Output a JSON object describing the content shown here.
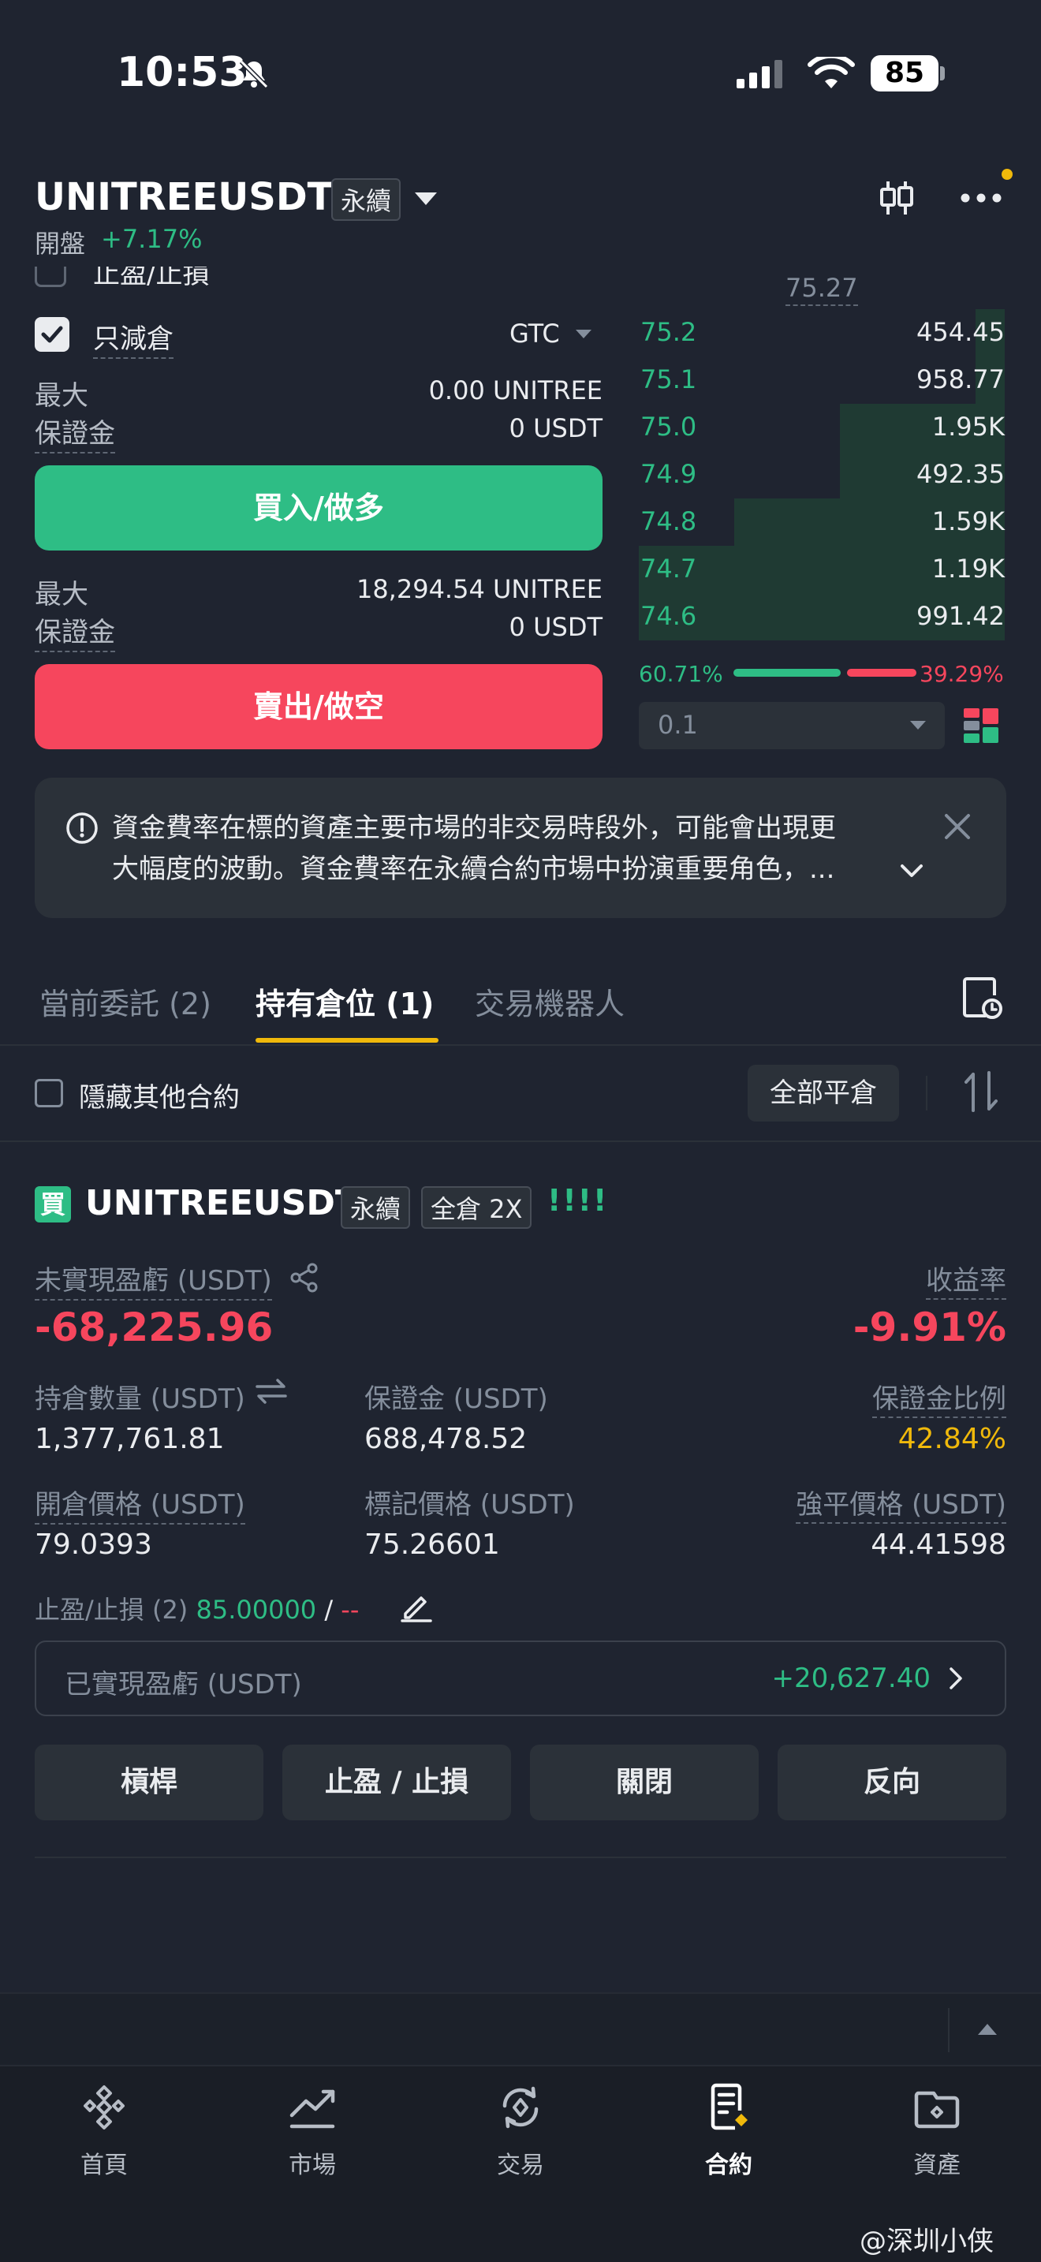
{
  "status_bar": {
    "time": "10:53",
    "battery": "85"
  },
  "header": {
    "symbol": "UNITREEUSDT",
    "contract_type": "永續",
    "open_label": "開盤",
    "open_change": "+7.17%"
  },
  "order_form": {
    "tpsl_label": "止盈/止損",
    "reduce_only_label": "只減倉",
    "reduce_only_checked": true,
    "tif": "GTC",
    "buy_max_label": "最大",
    "buy_max_value": "0.00 UNITREE",
    "buy_margin_label": "保證金",
    "buy_margin_value": "0 USDT",
    "buy_button": "買入/做多",
    "sell_max_label": "最大",
    "sell_max_value": "18,294.54 UNITREE",
    "sell_margin_label": "保證金",
    "sell_margin_value": "0 USDT",
    "sell_button": "賣出/做空"
  },
  "order_book": {
    "mid_price": "75.27",
    "bids": [
      {
        "price": "75.2",
        "qty": "454.45",
        "depth": 0.08
      },
      {
        "price": "75.1",
        "qty": "958.77",
        "depth": 0.08
      },
      {
        "price": "75.0",
        "qty": "1.95K",
        "depth": 0.45
      },
      {
        "price": "74.9",
        "qty": "492.35",
        "depth": 0.45
      },
      {
        "price": "74.8",
        "qty": "1.59K",
        "depth": 0.74
      },
      {
        "price": "74.7",
        "qty": "1.19K",
        "depth": 1.0
      },
      {
        "price": "74.6",
        "qty": "991.42",
        "depth": 1.0
      }
    ],
    "buy_ratio": "60.71%",
    "sell_ratio": "39.29%",
    "buy_ratio_value": 60.71,
    "depth_step": "0.1"
  },
  "notice": {
    "line1": "資金費率在標的資產主要市場的非交易時段外，可能會出現更",
    "line2": "大幅度的波動。資金費率在永續合約市場中扮演重要角色，..."
  },
  "tabs": {
    "open_orders": "當前委託 (2)",
    "positions": "持有倉位 (1)",
    "bots": "交易機器人"
  },
  "filters": {
    "hide_other": "隱藏其他合約",
    "close_all": "全部平倉"
  },
  "position": {
    "side_badge": "買",
    "symbol": "UNITREEUSDT",
    "contract_type": "永續",
    "margin_mode": "全倉 2X",
    "risk_bars": "!!!!",
    "upnl_label": "未實現盈虧 (USDT)",
    "upnl_value": "-68,225.96",
    "roe_label": "收益率",
    "roe_value": "-9.91%",
    "size_label": "持倉數量 (USDT)",
    "size_value": "1,377,761.81",
    "margin_label": "保證金 (USDT)",
    "margin_value": "688,478.52",
    "margin_ratio_label": "保證金比例",
    "margin_ratio_value": "42.84%",
    "entry_label": "開倉價格 (USDT)",
    "entry_value": "79.0393",
    "mark_label": "標記價格 (USDT)",
    "mark_value": "75.26601",
    "liq_label": "強平價格 (USDT)",
    "liq_value": "44.41598",
    "tpsl_label": "止盈/止損 (2)",
    "tp_value": "85.00000",
    "sl_value": "--",
    "realized_label": "已實現盈虧 (USDT)",
    "realized_value": "+20,627.40",
    "actions": [
      "槓桿",
      "止盈 / 止損",
      "關閉",
      "反向"
    ]
  },
  "nav": {
    "items": [
      "首頁",
      "市場",
      "交易",
      "合約",
      "資產"
    ],
    "active": "合約"
  },
  "watermark": "@深圳小侠",
  "colors": {
    "green": "#2ebd85",
    "red": "#f6465d",
    "yellow": "#f0b90b",
    "background": "#1f2430"
  }
}
